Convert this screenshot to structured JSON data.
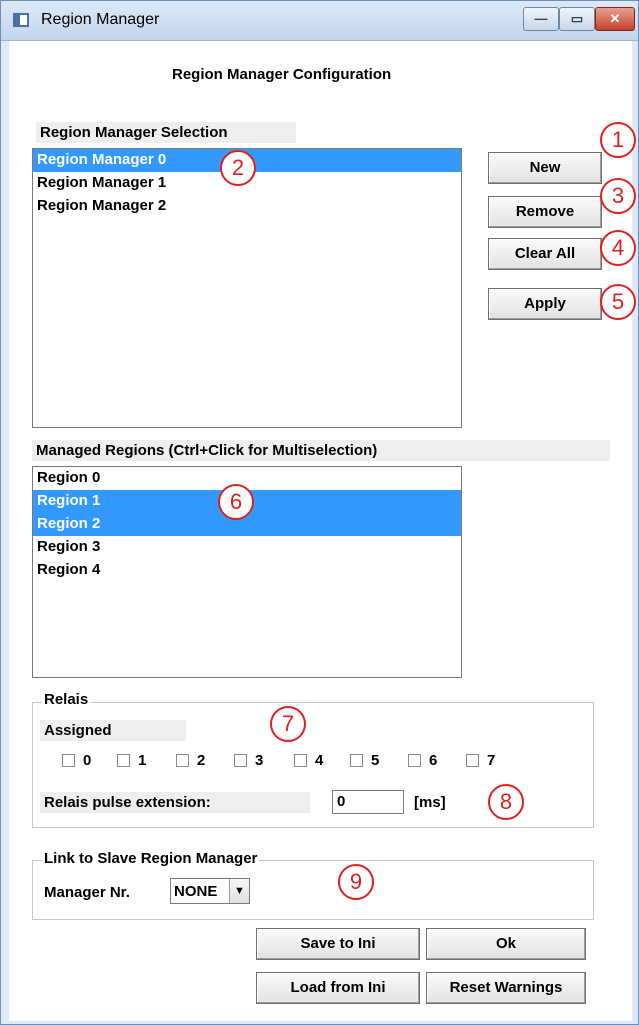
{
  "window": {
    "title": "Region Manager",
    "controls": {
      "minimize": "—",
      "maximize": "▭",
      "close": "✕"
    }
  },
  "header": "Region Manager Configuration",
  "selection": {
    "label": "Region Manager Selection",
    "items": [
      "Region Manager 0",
      "Region Manager 1",
      "Region Manager 2"
    ],
    "selected": "Region Manager 0"
  },
  "buttons": {
    "new": "New",
    "remove": "Remove",
    "clear_all": "Clear All",
    "apply": "Apply",
    "save_ini": "Save to Ini",
    "ok": "Ok",
    "load_ini": "Load from Ini",
    "reset_warnings": "Reset Warnings"
  },
  "managed": {
    "label": "Managed Regions (Ctrl+Click for Multiselection)",
    "items": [
      "Region 0",
      "Region 1",
      "Region 2",
      "Region 3",
      "Region 4"
    ],
    "selected": [
      "Region 1",
      "Region 2"
    ]
  },
  "relais": {
    "title": "Relais",
    "assigned_label": "Assigned",
    "checkboxes": [
      "0",
      "1",
      "2",
      "3",
      "4",
      "5",
      "6",
      "7"
    ],
    "checked": [],
    "pulse_label": "Relais pulse extension:",
    "pulse_value": "0",
    "pulse_unit": "[ms]"
  },
  "link": {
    "title": "Link to Slave Region Manager",
    "manager_label": "Manager Nr.",
    "manager_value": "NONE"
  },
  "callouts": [
    "1",
    "2",
    "3",
    "4",
    "5",
    "6",
    "7",
    "8",
    "9"
  ],
  "colors": {
    "selection": "#3399ff",
    "callout": "#e02020"
  }
}
